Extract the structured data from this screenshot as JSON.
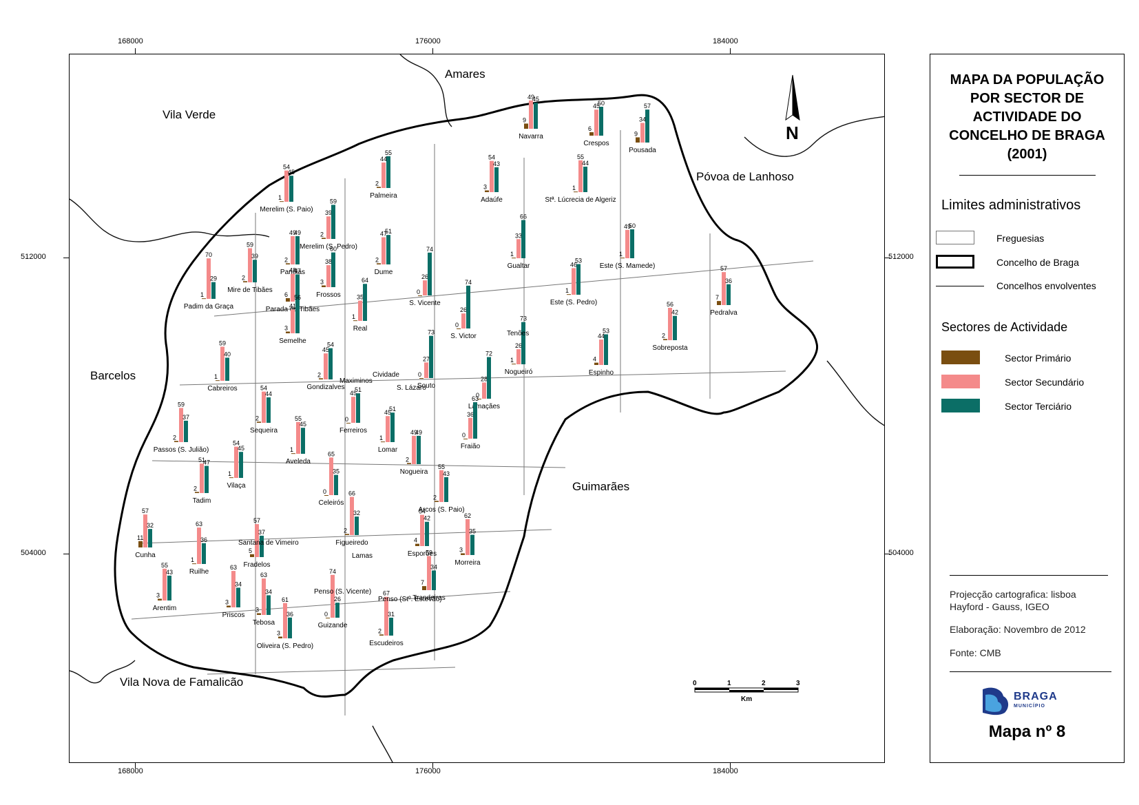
{
  "title_lines": [
    "MAPA DA POPULAÇÃO",
    "POR SECTOR DE",
    "ACTIVIDADE DO",
    "CONCELHO DE BRAGA",
    "(2001)"
  ],
  "coords": {
    "x": [
      "168000",
      "176000",
      "184000"
    ],
    "y": [
      "512000",
      "504000"
    ]
  },
  "north_label": "N",
  "neighbours": [
    "Amares",
    "Vila Verde",
    "Póvoa de Lanhoso",
    "Barcelos",
    "Guimarães",
    "Vila Nova de Famalicão"
  ],
  "legend": {
    "limits_heading": "Limites administrativos",
    "limits": [
      {
        "label": "Freguesias",
        "style": "parish"
      },
      {
        "label": "Concelho de Braga",
        "style": "municipality"
      },
      {
        "label": "Concelhos envolventes",
        "style": "neighbour"
      }
    ],
    "sectors_heading": "Sectores de Actividade",
    "sectors": [
      {
        "label": "Sector Primário",
        "color": "#7a4e10"
      },
      {
        "label": "Sector Secundário",
        "color": "#f48a8a"
      },
      {
        "label": "Sector Terciário",
        "color": "#0b6e66"
      }
    ]
  },
  "notes": [
    "Projecção cartografica: lisboa",
    "Hayford - Gauss, IGEO",
    "Elaboração: Novembro de 2012",
    "Fonte: CMB"
  ],
  "logo": {
    "name": "BRAGA",
    "sub": "MUNICÍPIO"
  },
  "map_number": "Mapa nº 8",
  "scale_bar": {
    "ticks": [
      "0",
      "1",
      "2",
      "3"
    ],
    "unit": "Km"
  },
  "parishes": [
    {
      "name": "Navarra",
      "values": [
        9,
        49,
        45
      ]
    },
    {
      "name": "Crespos",
      "values": [
        6,
        45,
        50
      ]
    },
    {
      "name": "Pousada",
      "values": [
        9,
        34,
        57
      ]
    },
    {
      "name": "Palmeira",
      "values": [
        2,
        44,
        55
      ]
    },
    {
      "name": "Adaúfe",
      "values": [
        3,
        54,
        43
      ]
    },
    {
      "name": "Merelim (S. Paio)",
      "values": [
        1,
        54,
        45
      ]
    },
    {
      "name": "Stª. Lúcrecia de Algeriz",
      "values": [
        1,
        55,
        44
      ]
    },
    {
      "name": "Merelim (S. Pedro)",
      "values": [
        2,
        39,
        59
      ]
    },
    {
      "name": "Este (S. Mamede)",
      "values": [
        1,
        49,
        50
      ]
    },
    {
      "name": "Panóias",
      "values": [
        2,
        49,
        49
      ]
    },
    {
      "name": "Mire de Tibães",
      "values": [
        2,
        59,
        39
      ]
    },
    {
      "name": "Padim da Graça",
      "values": [
        1,
        70,
        29
      ]
    },
    {
      "name": "Dume",
      "values": [
        2,
        47,
        51
      ]
    },
    {
      "name": "Frossos",
      "values": [
        3,
        38,
        60
      ]
    },
    {
      "name": "Parada de Tibães",
      "values": [
        6,
        48,
        47
      ]
    },
    {
      "name": "Gualtar",
      "values": [
        1,
        33,
        66
      ]
    },
    {
      "name": "Este (S. Pedro)",
      "values": [
        1,
        46,
        53
      ]
    },
    {
      "name": "Pedralva",
      "values": [
        7,
        57,
        36
      ]
    },
    {
      "name": "Real",
      "values": [
        1,
        35,
        64
      ]
    },
    {
      "name": "S. Vicente",
      "values": [
        0,
        26,
        74
      ]
    },
    {
      "name": "S. Victor",
      "values": [
        0,
        26,
        74
      ]
    },
    {
      "name": "Sobreposta",
      "values": [
        2,
        56,
        42
      ]
    },
    {
      "name": "Semelhe",
      "values": [
        3,
        41,
        56
      ]
    },
    {
      "name": "Espinho",
      "values": [
        4,
        44,
        53
      ]
    },
    {
      "name": "Cabreiros",
      "values": [
        1,
        59,
        40
      ]
    },
    {
      "name": "Gondizalves",
      "values": [
        2,
        45,
        54
      ]
    },
    {
      "name": "Souto",
      "values": [
        0,
        27,
        73
      ]
    },
    {
      "name": "Nogueiró",
      "values": [
        1,
        26,
        73
      ]
    },
    {
      "name": "Lamaçães",
      "values": [
        0,
        28,
        72
      ]
    },
    {
      "name": "Passos (S. Julião)",
      "values": [
        2,
        59,
        37
      ]
    },
    {
      "name": "Sequeira",
      "values": [
        2,
        54,
        44
      ]
    },
    {
      "name": "Ferreiros",
      "values": [
        0,
        45,
        51
      ]
    },
    {
      "name": "Fraião",
      "values": [
        0,
        36,
        63
      ]
    },
    {
      "name": "Aveleda",
      "values": [
        1,
        55,
        45
      ]
    },
    {
      "name": "Lomar",
      "values": [
        1,
        45,
        51
      ]
    },
    {
      "name": "Nogueira",
      "values": [
        2,
        49,
        49
      ]
    },
    {
      "name": "Tadim",
      "values": [
        2,
        51,
        47
      ]
    },
    {
      "name": "Vilaça",
      "values": [
        1,
        54,
        45
      ]
    },
    {
      "name": "Arcos (S. Paio)",
      "values": [
        2,
        55,
        43
      ]
    },
    {
      "name": "Celeirós",
      "values": [
        0,
        65,
        35
      ]
    },
    {
      "name": "Esporões",
      "values": [
        4,
        54,
        42
      ]
    },
    {
      "name": "Figueiredo",
      "values": [
        2,
        66,
        32
      ]
    },
    {
      "name": "Fradelos",
      "values": [
        5,
        57,
        37
      ]
    },
    {
      "name": "Morreira",
      "values": [
        3,
        62,
        35
      ]
    },
    {
      "name": "Cunha",
      "values": [
        11,
        57,
        32
      ]
    },
    {
      "name": "Ruilhe",
      "values": [
        1,
        63,
        36
      ]
    },
    {
      "name": "Priscos",
      "values": [
        3,
        63,
        34
      ]
    },
    {
      "name": "Arentim",
      "values": [
        3,
        55,
        43
      ]
    },
    {
      "name": "Tebosa",
      "values": [
        3,
        63,
        34
      ]
    },
    {
      "name": "Guizande",
      "values": [
        0,
        74,
        26
      ]
    },
    {
      "name": "Oliveira (S. Pedro)",
      "values": [
        3,
        61,
        36
      ]
    },
    {
      "name": "Escudeiros",
      "values": [
        2,
        67,
        31
      ]
    },
    {
      "name": "Trandeiras",
      "values": [
        7,
        59,
        34
      ]
    }
  ],
  "unread_parish_labels": [
    "Maximinos",
    "Cividade",
    "S. Lázaro",
    "Tenões",
    "Lamas",
    "Santana de Vimeiro",
    "Penso (S. Vicente)",
    "Penso (Stº. Estevão)"
  ]
}
